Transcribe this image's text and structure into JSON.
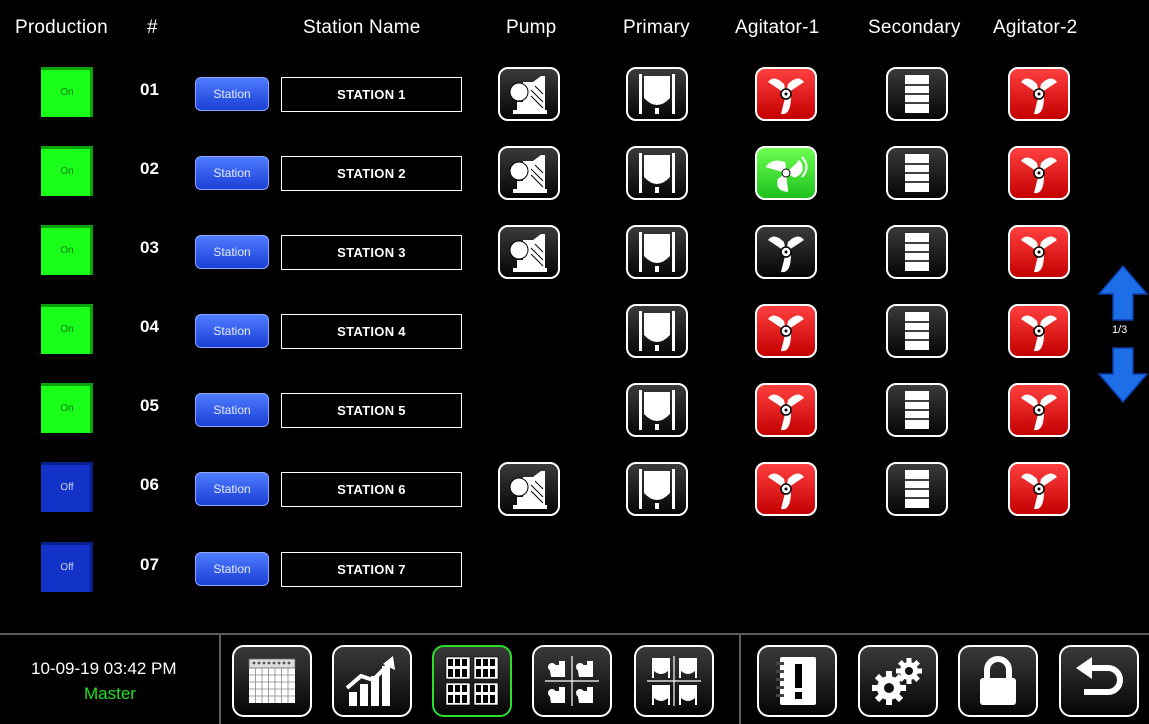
{
  "header": {
    "production": "Production",
    "number": "#",
    "station_name": "Station Name",
    "pump": "Pump",
    "primary": "Primary",
    "agitator1": "Agitator-1",
    "secondary": "Secondary",
    "agitator2": "Agitator-2"
  },
  "station_button_label": "Station",
  "rows": [
    {
      "production": "On",
      "production_state": "on",
      "number": "01",
      "name": "STATION 1",
      "pump": true,
      "primary": true,
      "agitator1": "red",
      "secondary": true,
      "agitator2": "red"
    },
    {
      "production": "On",
      "production_state": "on",
      "number": "02",
      "name": "STATION 2",
      "pump": true,
      "primary": true,
      "agitator1": "green",
      "secondary": true,
      "agitator2": "red"
    },
    {
      "production": "On",
      "production_state": "on",
      "number": "03",
      "name": "STATION 3",
      "pump": true,
      "primary": true,
      "agitator1": "dark",
      "secondary": true,
      "agitator2": "red"
    },
    {
      "production": "On",
      "production_state": "on",
      "number": "04",
      "name": "STATION 4",
      "pump": false,
      "primary": true,
      "agitator1": "red",
      "secondary": true,
      "agitator2": "red"
    },
    {
      "production": "On",
      "production_state": "on",
      "number": "05",
      "name": "STATION 5",
      "pump": false,
      "primary": true,
      "agitator1": "red",
      "secondary": true,
      "agitator2": "red"
    },
    {
      "production": "Off",
      "production_state": "off",
      "number": "06",
      "name": "STATION 6",
      "pump": true,
      "primary": true,
      "agitator1": "red",
      "secondary": true,
      "agitator2": "red"
    },
    {
      "production": "Off",
      "production_state": "off",
      "number": "07",
      "name": "STATION 7",
      "pump": false,
      "primary": false,
      "agitator1": null,
      "secondary": false,
      "agitator2": null
    }
  ],
  "pager": {
    "page_indicator": "1/3"
  },
  "footer": {
    "datetime": "10-09-19 03:42 PM",
    "user": "Master",
    "nav_icons": [
      "calendar-icon",
      "trend-chart-icon",
      "station-grid-icon",
      "pumps-grid-icon",
      "tanks-grid-icon",
      "alarm-log-icon",
      "settings-gears-icon",
      "lock-icon",
      "back-icon"
    ]
  },
  "colors": {
    "on": "#19ff19",
    "off": "#1232c8",
    "agitator_off": "#e01010",
    "agitator_running": "#3ee03e",
    "station_button": "#2d55e8",
    "user_text": "#22e022",
    "nav_active_border": "#2cde2c"
  }
}
